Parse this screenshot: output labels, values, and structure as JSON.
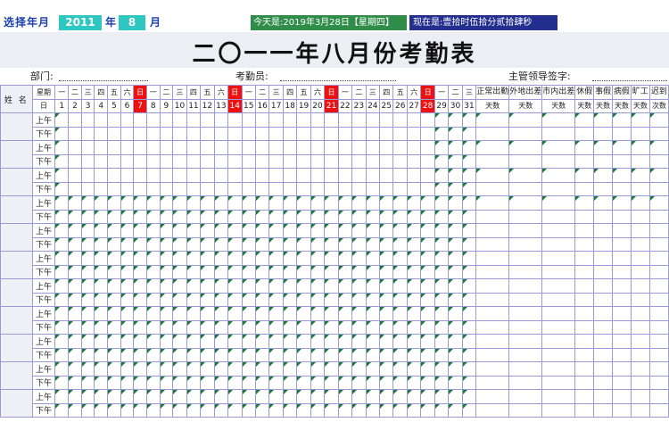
{
  "toolbar": {
    "select_label": "选择年月",
    "year": "2011",
    "year_unit": "年",
    "month": "8",
    "month_unit": "月",
    "today_text": "今天是:2019年3月28日【星期四】",
    "now_text": "现在是:壹拾时伍拾分贰拾肆秒"
  },
  "title": "二〇一一年八月份考勤表",
  "meta": {
    "department": "部门:",
    "clerk": "考勤员:",
    "supervisor": "主管领导签字:"
  },
  "grid": {
    "name_header": "姓 名",
    "weekday_header": "星期",
    "day_header": "日",
    "weekdays": [
      "一",
      "二",
      "三",
      "四",
      "五",
      "六",
      "日",
      "一",
      "二",
      "三",
      "四",
      "五",
      "六",
      "日",
      "一",
      "二",
      "三",
      "四",
      "五",
      "六",
      "日",
      "一",
      "二",
      "三",
      "四",
      "五",
      "六",
      "日",
      "一",
      "二",
      "三"
    ],
    "days": [
      "1",
      "2",
      "3",
      "4",
      "5",
      "6",
      "7",
      "8",
      "9",
      "10",
      "11",
      "12",
      "13",
      "14",
      "15",
      "16",
      "17",
      "18",
      "19",
      "20",
      "21",
      "22",
      "23",
      "24",
      "25",
      "26",
      "27",
      "28",
      "29",
      "30",
      "31"
    ],
    "summary_headers": [
      "正常出勤",
      "外地出差",
      "市内出差",
      "休假",
      "事假",
      "病假",
      "旷工",
      "迟到"
    ],
    "summary_units": [
      "天数",
      "天数",
      "天数",
      "天数",
      "天数",
      "天数",
      "天数",
      "次数"
    ],
    "am_label": "上午",
    "pm_label": "下午"
  },
  "colors": {
    "sunday": "#ee1111",
    "year_cell": "#2fc7c1",
    "today_box": "#2f8c49",
    "now_box": "#232f8f",
    "grid_line": "#9a9ad6"
  }
}
